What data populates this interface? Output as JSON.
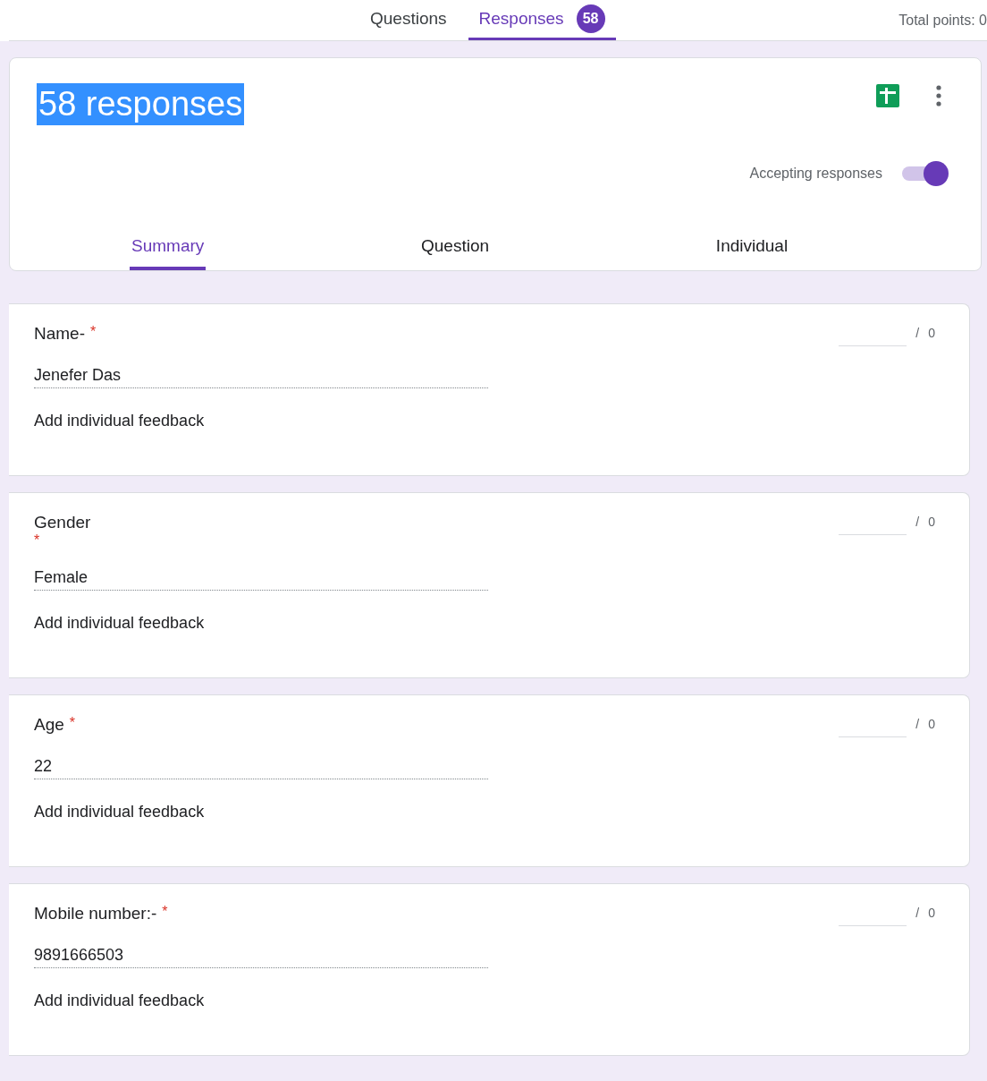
{
  "top_tabs": [
    {
      "label": "Questions",
      "selected": false
    },
    {
      "label": "Responses",
      "selected": true,
      "badge": "58"
    }
  ],
  "total_points": "Total points: 0",
  "header": {
    "title": "58 responses",
    "title_highlighted": true,
    "accepting_label": "Accepting responses",
    "accepting_on": true
  },
  "view_tabs": [
    {
      "label": "Summary",
      "selected": true
    },
    {
      "label": "Question",
      "selected": false
    },
    {
      "label": "Individual",
      "selected": false
    }
  ],
  "questions": [
    {
      "label": "Name-",
      "required_mark": "*",
      "kind": "inline",
      "answer": "Jenefer Das",
      "feedback": "Add individual feedback",
      "separator": "/",
      "points_max": "0"
    },
    {
      "label": "Gender",
      "required_mark": "*",
      "kind": "wrapped",
      "answer": "Female",
      "feedback": "Add individual feedback",
      "separator": "/",
      "points_max": "0"
    },
    {
      "label": "Age",
      "required_mark": "*",
      "kind": "inline",
      "answer": "22",
      "feedback": "Add individual feedback",
      "separator": "/",
      "points_max": "0"
    },
    {
      "label": "Mobile number:-",
      "required_mark": "*",
      "kind": "inline",
      "answer": "9891666503",
      "feedback": "Add individual feedback",
      "separator": "/",
      "points_max": "0"
    }
  ]
}
